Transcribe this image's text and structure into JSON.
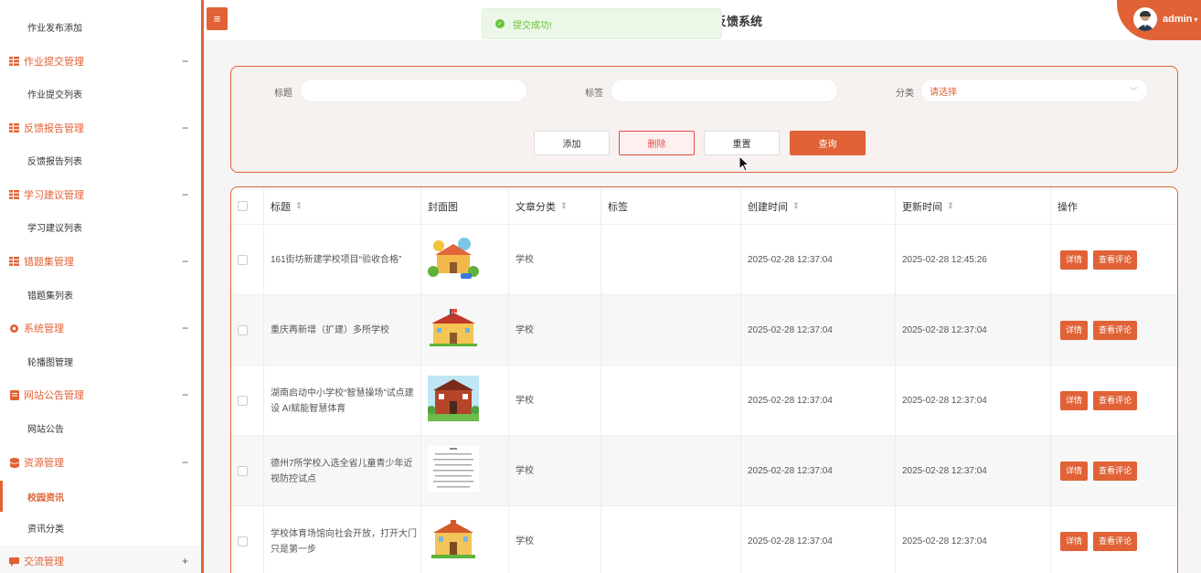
{
  "sidebar": {
    "items": [
      {
        "type": "sub",
        "label": "作业发布添加"
      },
      {
        "type": "group",
        "label": "作业提交管理",
        "icon": "grid-icon",
        "toggle": "−"
      },
      {
        "type": "sub",
        "label": "作业提交列表"
      },
      {
        "type": "group",
        "label": "反馈报告管理",
        "icon": "grid-icon",
        "toggle": "−"
      },
      {
        "type": "sub",
        "label": "反馈报告列表"
      },
      {
        "type": "group",
        "label": "学习建议管理",
        "icon": "grid-icon",
        "toggle": "−"
      },
      {
        "type": "sub",
        "label": "学习建议列表"
      },
      {
        "type": "group",
        "label": "错题集管理",
        "icon": "grid-icon",
        "toggle": "−"
      },
      {
        "type": "sub",
        "label": "错题集列表"
      },
      {
        "type": "group",
        "label": "系统管理",
        "icon": "gear-icon",
        "toggle": "−"
      },
      {
        "type": "sub",
        "label": "轮播图管理"
      },
      {
        "type": "group",
        "label": "网站公告管理",
        "icon": "document-icon",
        "toggle": "−"
      },
      {
        "type": "sub",
        "label": "网站公告"
      },
      {
        "type": "group",
        "label": "资源管理",
        "icon": "database-icon",
        "toggle": "−"
      },
      {
        "type": "sub",
        "label": "校园资讯",
        "active": true
      },
      {
        "type": "sub",
        "label": "资讯分类"
      },
      {
        "type": "group",
        "label": "交流管理",
        "icon": "chat-icon",
        "toggle": "+"
      }
    ]
  },
  "header": {
    "menu_icon": "≡",
    "title": "反馈系统",
    "toast": "提交成功!",
    "user": "admin"
  },
  "search": {
    "title_label": "标题",
    "tag_label": "标签",
    "category_label": "分类",
    "category_value": "请选择",
    "buttons": {
      "add": "添加",
      "delete": "删除",
      "reset": "重置",
      "query": "查询"
    }
  },
  "table": {
    "columns": [
      "标题",
      "封面图",
      "文章分类",
      "标签",
      "创建时间",
      "更新时间",
      "操作"
    ],
    "rows": [
      {
        "title": "161街坊新建学校项目“验收合格”",
        "category": "学校",
        "tag": "",
        "created": "2025-02-28 12:37:04",
        "updated": "2025-02-28 12:45:26"
      },
      {
        "title": "重庆再新增（扩建）多所学校",
        "category": "学校",
        "tag": "",
        "created": "2025-02-28 12:37:04",
        "updated": "2025-02-28 12:37:04"
      },
      {
        "title": "湖南启动中小学校“智慧操场”试点建设 AI赋能智慧体育",
        "category": "学校",
        "tag": "",
        "created": "2025-02-28 12:37:04",
        "updated": "2025-02-28 12:37:04"
      },
      {
        "title": "德州7所学校入选全省儿童青少年近视防控试点",
        "category": "学校",
        "tag": "",
        "created": "2025-02-28 12:37:04",
        "updated": "2025-02-28 12:37:04"
      },
      {
        "title": "学校体育场馆向社会开放，打开大门只是第一步",
        "category": "学校",
        "tag": "",
        "created": "2025-02-28 12:37:04",
        "updated": "2025-02-28 12:37:04"
      }
    ],
    "op_detail": "详情",
    "op_comments": "查看评论"
  },
  "colors": {
    "accent": "#e06236",
    "success": "#67c23a",
    "danger": "#e24c4c"
  }
}
